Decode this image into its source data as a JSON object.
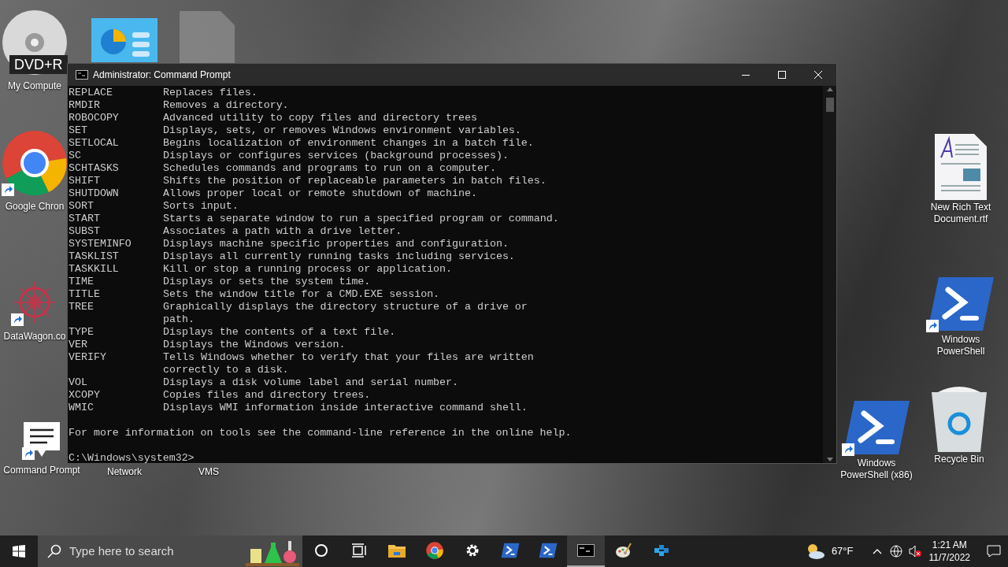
{
  "desktop_icons": [
    {
      "kind": "disc",
      "label": "My Compute",
      "tooltip": "DVD+R"
    },
    {
      "kind": "panel"
    },
    {
      "kind": "file"
    },
    {
      "kind": "chrome",
      "label": "Google Chron"
    },
    {
      "kind": "virus",
      "label": "DataWagon.co"
    },
    {
      "kind": "note",
      "label": "Command Prompt"
    },
    {
      "kind": "none",
      "label": "Network"
    },
    {
      "kind": "none",
      "label": "VMS"
    },
    {
      "kind": "rtf",
      "label": "New Rich Text Document.rtf"
    },
    {
      "kind": "powershell",
      "label": "Windows PowerShell"
    },
    {
      "kind": "powershell",
      "label": "Windows PowerShell (x86)"
    },
    {
      "kind": "recycle",
      "label": "Recycle Bin"
    }
  ],
  "window": {
    "title": "Administrator: Command Prompt",
    "lines": [
      {
        "command": "REPLACE",
        "text": "Replaces files."
      },
      {
        "command": "RMDIR",
        "text": "Removes a directory."
      },
      {
        "command": "ROBOCOPY",
        "text": "Advanced utility to copy files and directory trees"
      },
      {
        "command": "SET",
        "text": "Displays, sets, or removes Windows environment variables."
      },
      {
        "command": "SETLOCAL",
        "text": "Begins localization of environment changes in a batch file."
      },
      {
        "command": "SC",
        "text": "Displays or configures services (background processes)."
      },
      {
        "command": "SCHTASKS",
        "text": "Schedules commands and programs to run on a computer."
      },
      {
        "command": "SHIFT",
        "text": "Shifts the position of replaceable parameters in batch files."
      },
      {
        "command": "SHUTDOWN",
        "text": "Allows proper local or remote shutdown of machine."
      },
      {
        "command": "SORT",
        "text": "Sorts input."
      },
      {
        "command": "START",
        "text": "Starts a separate window to run a specified program or command."
      },
      {
        "command": "SUBST",
        "text": "Associates a path with a drive letter."
      },
      {
        "command": "SYSTEMINFO",
        "text": "Displays machine specific properties and configuration."
      },
      {
        "command": "TASKLIST",
        "text": "Displays all currently running tasks including services."
      },
      {
        "command": "TASKKILL",
        "text": "Kill or stop a running process or application."
      },
      {
        "command": "TIME",
        "text": "Displays or sets the system time."
      },
      {
        "command": "TITLE",
        "text": "Sets the window title for a CMD.EXE session."
      },
      {
        "command": "TREE",
        "text": "Graphically displays the directory structure of a drive or"
      },
      {
        "text": "path."
      },
      {
        "command": "TYPE",
        "text": "Displays the contents of a text file."
      },
      {
        "command": "VER",
        "text": "Displays the Windows version."
      },
      {
        "command": "VERIFY",
        "text": "Tells Windows whether to verify that your files are written"
      },
      {
        "text": "correctly to a disk."
      },
      {
        "command": "VOL",
        "text": "Displays a disk volume label and serial number."
      },
      {
        "command": "XCOPY",
        "text": "Copies files and directory trees."
      },
      {
        "command": "WMIC",
        "text": "Displays WMI information inside interactive command shell."
      }
    ],
    "footer": "For more information on tools see the command-line reference in the online help.",
    "prompt": "C:\\Windows\\system32>"
  },
  "taskbar": {
    "search_placeholder": "Type here to search",
    "apps": [
      {
        "kind": "cortana",
        "selected": false
      },
      {
        "kind": "taskview",
        "selected": false
      },
      {
        "kind": "folder",
        "selected": false
      },
      {
        "kind": "chrome",
        "selected": false
      },
      {
        "kind": "gear",
        "selected": false
      },
      {
        "kind": "powershell",
        "selected": false
      },
      {
        "kind": "powershell",
        "selected": false
      },
      {
        "kind": "console",
        "selected": true
      },
      {
        "kind": "paint",
        "selected": false
      },
      {
        "kind": "cubes",
        "selected": false
      }
    ],
    "temperature": "67°F",
    "time": "1:21 AM",
    "date": "11/7/2022"
  }
}
